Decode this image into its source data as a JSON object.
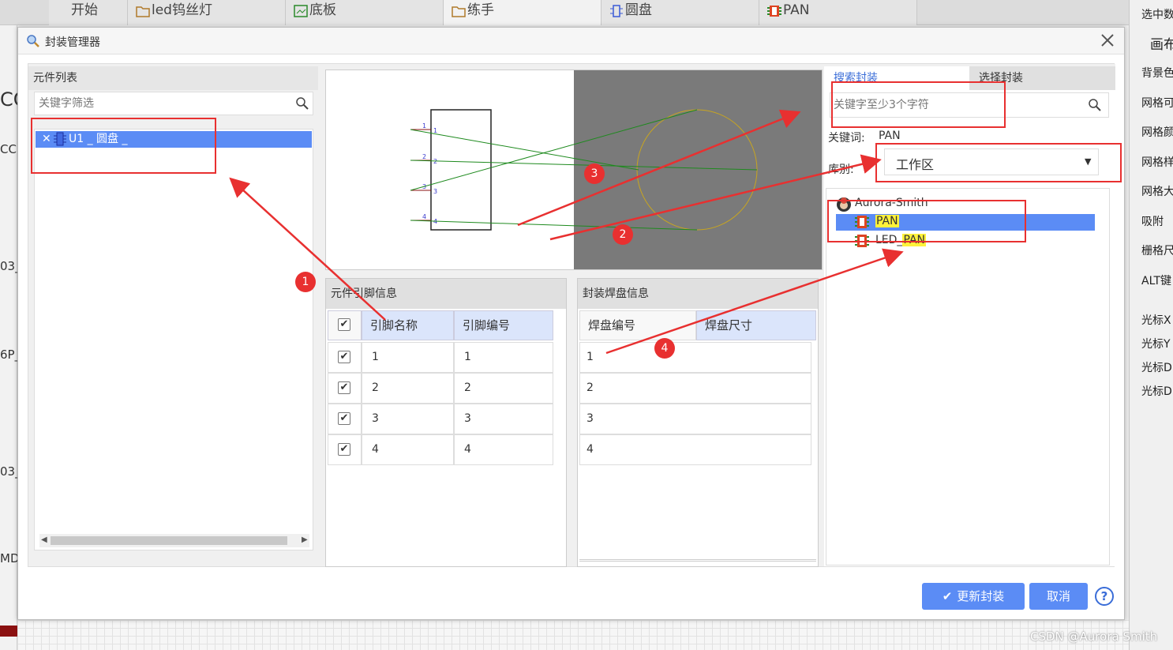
{
  "tabs": [
    {
      "label": "开始"
    },
    {
      "label": "led钨丝灯"
    },
    {
      "label": "底板"
    },
    {
      "label": "练手"
    },
    {
      "label": "圆盘"
    },
    {
      "label": "PAN"
    }
  ],
  "left_strip": [
    "CC",
    "CC",
    "03_",
    "6P_",
    "03_",
    "MD"
  ],
  "right_panel": {
    "top": "选中数",
    "section": "画布",
    "items": [
      "背景色",
      "网格可",
      "网格颜",
      "网格样",
      "网格大",
      "吸附",
      "栅格尺",
      "ALT键"
    ],
    "cursor": [
      "光标X",
      "光标Y",
      "光标D",
      "光标D"
    ]
  },
  "dialog": {
    "title": "封装管理器",
    "component_list": {
      "header": "元件列表",
      "filter_placeholder": "关键字筛选",
      "items": [
        "U1 _ 圆盘 _"
      ]
    },
    "pin_info": {
      "header": "元件引脚信息",
      "col_name": "引脚名称",
      "col_number": "引脚编号",
      "rows": [
        {
          "name": "1",
          "number": "1"
        },
        {
          "name": "2",
          "number": "2"
        },
        {
          "name": "3",
          "number": "3"
        },
        {
          "name": "4",
          "number": "4"
        }
      ]
    },
    "pad_info": {
      "header": "封装焊盘信息",
      "col_number": "焊盘编号",
      "col_size": "焊盘尺寸",
      "rows": [
        "1",
        "2",
        "3",
        "4"
      ]
    },
    "search": {
      "tab_search": "搜索封装",
      "tab_select": "选择封装",
      "placeholder": "关键字至少3个字符",
      "keyword_label": "关键词:",
      "keyword_value": "PAN",
      "library_label": "库别:",
      "library_value": "工作区",
      "owner": "Aurora-Smith",
      "results": [
        {
          "prefix": "",
          "match": "PAN"
        },
        {
          "prefix": "LED_",
          "match": "PAN"
        }
      ]
    },
    "update_button": "更新封装",
    "cancel_button": "取消",
    "help_icon": "?"
  },
  "preview": {
    "pin_labels": [
      "1",
      "2",
      "3",
      "4"
    ]
  },
  "annotations": [
    "1",
    "2",
    "3",
    "4"
  ],
  "watermark": "CSDN @Aurora Smith",
  "colors": {
    "accent": "#5b8cf5",
    "annotation": "#e83030",
    "highlight": "#fff23a",
    "pcb_bg": "#7a7a7a",
    "net": "#1e8a1e"
  }
}
